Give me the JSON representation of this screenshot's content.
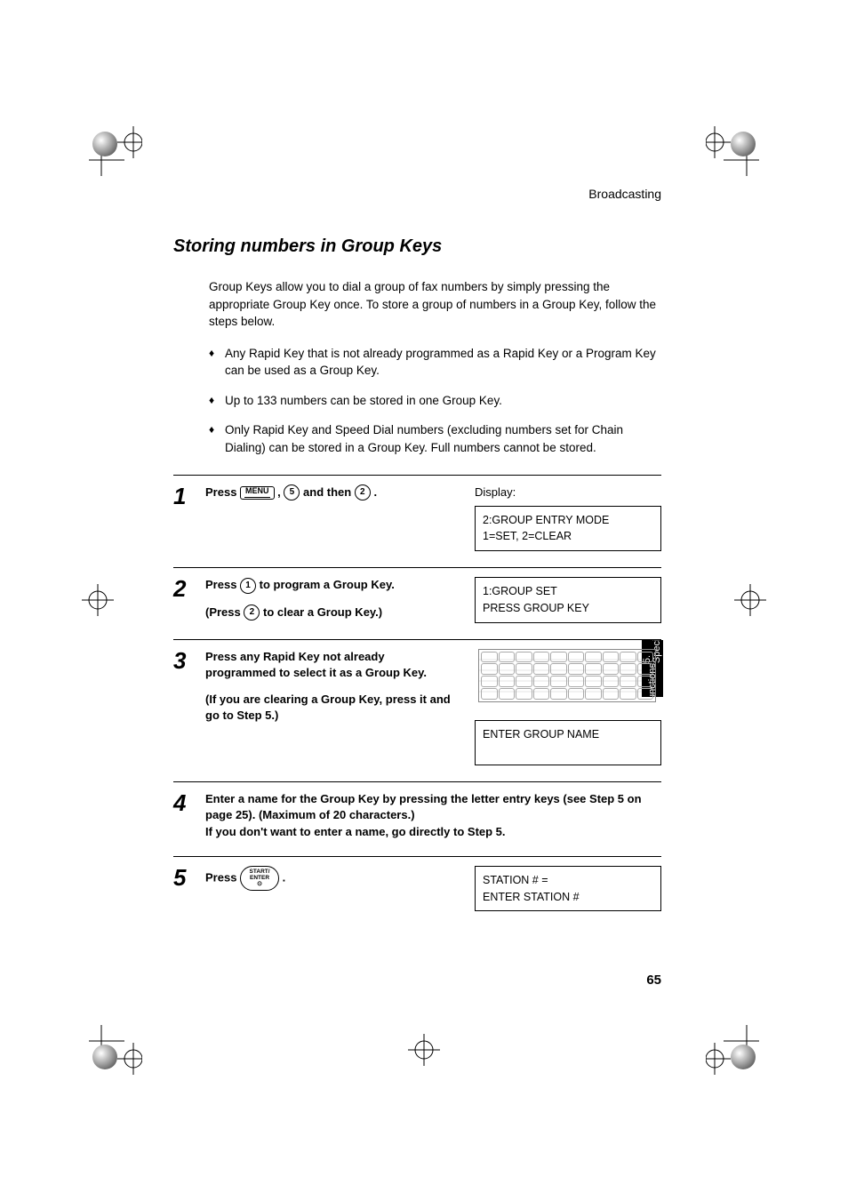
{
  "running_head": "Broadcasting",
  "section_title": "Storing numbers in Group Keys",
  "intro": "Group Keys allow you to dial a group of fax numbers by simply pressing the appropriate Group Key once. To store a group of numbers in a Group Key, follow the steps below.",
  "bullets": [
    "Any Rapid Key that is not already programmed as a Rapid Key or a Program Key can be used as a Group Key.",
    "Up to 133 numbers can be stored in one Group Key.",
    "Only Rapid Key and Speed Dial numbers (excluding numbers set for Chain Dialing) can be stored in a Group Key. Full numbers cannot be stored."
  ],
  "keys": {
    "menu": "MENU",
    "k5": "5",
    "k2": "2",
    "k1": "1",
    "start_enter_top": "START/",
    "start_enter_bottom": "ENTER"
  },
  "steps": {
    "s1": {
      "num": "1",
      "press": "Press",
      "mid": " , ",
      "after": " and then ",
      "end": " .",
      "display_label": "Display:",
      "display_line1": "2:GROUP ENTRY MODE",
      "display_line2": "1=SET, 2=CLEAR"
    },
    "s2": {
      "num": "2",
      "press": "Press ",
      "after": " to program a Group Key.",
      "sub_pre": "(Press ",
      "sub_post": " to clear a Group Key.)",
      "display_line1": "1:GROUP SET",
      "display_line2": "PRESS GROUP KEY"
    },
    "s3": {
      "num": "3",
      "text": "Press any Rapid Key not already programmed to select it as a Group Key.",
      "sub": "(If you are clearing a Group Key, press it and go to Step 5.)",
      "display_line1": "ENTER GROUP NAME"
    },
    "s4": {
      "num": "4",
      "line1": "Enter a name for the Group Key by pressing the letter entry keys (see Step 5 on page 25). (Maximum of 20 characters.)",
      "line2": "If you don't want to enter a name, go directly to Step 5."
    },
    "s5": {
      "num": "5",
      "press": "Press ",
      "end": " .",
      "display_line1": "STATION # =",
      "display_line2": "ENTER STATION #"
    }
  },
  "side_tab": {
    "line1": "5. Special",
    "line2": "Functions"
  },
  "page_number": "65"
}
